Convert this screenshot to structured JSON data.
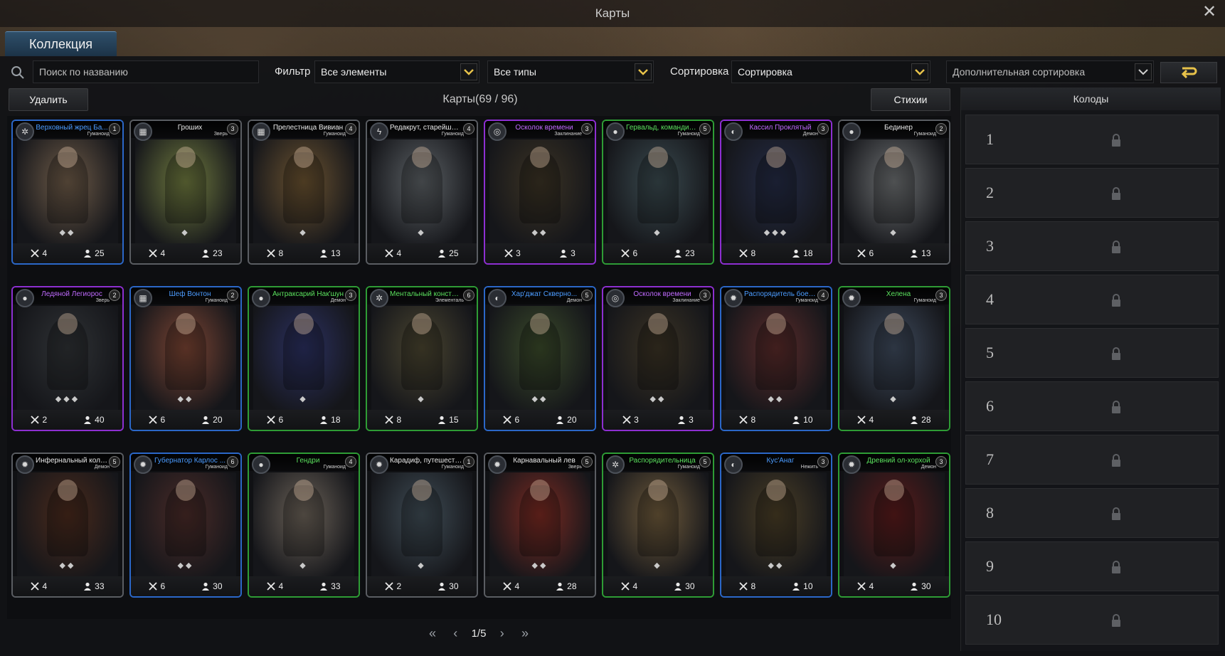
{
  "window": {
    "title": "Карты",
    "close": "✕"
  },
  "tabs": [
    {
      "label": "Коллекция"
    }
  ],
  "toolbar": {
    "search_placeholder": "Поиск по названию",
    "filter_label": "Фильтр",
    "element_filter": "Все элементы",
    "type_filter": "Все типы",
    "sort_label": "Сортировка",
    "sort_value": "Сортировка",
    "extra_sort": "Дополнительная сортировка",
    "apply_icon": "return-arrow-icon"
  },
  "actions": {
    "delete": "Удалить",
    "elements": "Стихии"
  },
  "collection": {
    "count_label": "Карты(69 / 96)"
  },
  "cards": [
    {
      "name": "Верховный жрец Ба...",
      "type": "Гуманоид",
      "cost": "1",
      "attack": "4",
      "health": "25",
      "rarity": "blue",
      "elem": "✲",
      "gems": "◆◆",
      "tint": "#6e5b48"
    },
    {
      "name": "Гроших",
      "type": "Зверь",
      "cost": "3",
      "attack": "4",
      "health": "23",
      "rarity": "grey",
      "elem": "▦",
      "gems": "◆",
      "tint": "#6f7a3f"
    },
    {
      "name": "Прелестница Вивиан",
      "type": "Гуманоид",
      "cost": "4",
      "attack": "8",
      "health": "13",
      "rarity": "grey",
      "elem": "▦",
      "gems": "◆",
      "tint": "#6a5230"
    },
    {
      "name": "Редакрут, старейшин...",
      "type": "Гуманоид",
      "cost": "4",
      "attack": "4",
      "health": "25",
      "rarity": "grey",
      "elem": "ϟ",
      "gems": "◆",
      "tint": "#5b6064"
    },
    {
      "name": "Осколок времени",
      "type": "Заклинание",
      "cost": "3",
      "attack": "3",
      "health": "3",
      "rarity": "purple",
      "elem": "◎",
      "gems": "◆◆",
      "tint": "#3b3324"
    },
    {
      "name": "Гервальд, командир ...",
      "type": "Гуманоид",
      "cost": "5",
      "attack": "6",
      "health": "23",
      "rarity": "green",
      "elem": "●",
      "gems": "◆",
      "tint": "#3a4a4f"
    },
    {
      "name": "Кассил Проклятый",
      "type": "Демон",
      "cost": "3",
      "attack": "8",
      "health": "18",
      "rarity": "purple",
      "elem": "◐",
      "gems": "◆◆◆",
      "tint": "#242b45"
    },
    {
      "name": "Бединер",
      "type": "Гуманоид",
      "cost": "2",
      "attack": "6",
      "health": "13",
      "rarity": "grey",
      "elem": "●",
      "gems": "◆",
      "tint": "#6d7072"
    },
    {
      "name": "Ледяной Легиорос",
      "type": "Зверь",
      "cost": "2",
      "attack": "2",
      "health": "40",
      "rarity": "purple",
      "elem": "●",
      "gems": "◆◆◆",
      "tint": "#2f3235"
    },
    {
      "name": "Шеф Вонтон",
      "type": "Гуманоид",
      "cost": "2",
      "attack": "6",
      "health": "20",
      "rarity": "blue",
      "elem": "▦",
      "gems": "◆◆",
      "tint": "#7a4433"
    },
    {
      "name": "Антраксарий Нак'шун",
      "type": "Демон",
      "cost": "3",
      "attack": "6",
      "health": "18",
      "rarity": "green",
      "elem": "●",
      "gems": "◆",
      "tint": "#2b3060"
    },
    {
      "name": "Ментальный констру...",
      "type": "Элементаль",
      "cost": "6",
      "attack": "8",
      "health": "15",
      "rarity": "green",
      "elem": "✲",
      "gems": "◆",
      "tint": "#4a4530"
    },
    {
      "name": "Хар'джат Скверно...",
      "type": "Демон",
      "cost": "5",
      "attack": "6",
      "health": "20",
      "rarity": "blue",
      "elem": "◐",
      "gems": "◆◆",
      "tint": "#3a4a2a"
    },
    {
      "name": "Осколок времени",
      "type": "Заклинание",
      "cost": "3",
      "attack": "3",
      "health": "3",
      "rarity": "purple",
      "elem": "◎",
      "gems": "◆◆",
      "tint": "#3b3324"
    },
    {
      "name": "Распорядитель боев...",
      "type": "Гуманоид",
      "cost": "4",
      "attack": "8",
      "health": "10",
      "rarity": "blue",
      "elem": "✹",
      "gems": "◆◆",
      "tint": "#5a2b2a"
    },
    {
      "name": "Хелена",
      "type": "Гуманоид",
      "cost": "3",
      "attack": "4",
      "health": "28",
      "rarity": "green",
      "elem": "✹",
      "gems": "◆",
      "tint": "#3e4a5c"
    },
    {
      "name": "Инфернальный коло...",
      "type": "Демон",
      "cost": "5",
      "attack": "4",
      "health": "33",
      "rarity": "grey",
      "elem": "✹",
      "gems": "◆◆",
      "tint": "#4a2a1c"
    },
    {
      "name": "Губернатор Карлос ...",
      "type": "Гуманоид",
      "cost": "6",
      "attack": "6",
      "health": "30",
      "rarity": "blue",
      "elem": "✹",
      "gems": "◆◆",
      "tint": "#4a2b28"
    },
    {
      "name": "Гендри",
      "type": "Гуманоид",
      "cost": "4",
      "attack": "4",
      "health": "33",
      "rarity": "green",
      "elem": "●",
      "gems": "◆",
      "tint": "#6b6258"
    },
    {
      "name": "Карадиф, путешествен...",
      "type": "Гуманоид",
      "cost": "1",
      "attack": "2",
      "health": "30",
      "rarity": "grey",
      "elem": "✹",
      "gems": "◆",
      "tint": "#3f4c55"
    },
    {
      "name": "Карнавальный лев",
      "type": "Зверь",
      "cost": "5",
      "attack": "4",
      "health": "28",
      "rarity": "grey",
      "elem": "✹",
      "gems": "◆◆",
      "tint": "#7a2a22"
    },
    {
      "name": "Распорядительница",
      "type": "Гуманоид",
      "cost": "5",
      "attack": "4",
      "health": "30",
      "rarity": "green",
      "elem": "✲",
      "gems": "◆",
      "tint": "#6e5a3b"
    },
    {
      "name": "Кус'Анаг",
      "type": "Нежить",
      "cost": "3",
      "attack": "8",
      "health": "10",
      "rarity": "blue",
      "elem": "◐",
      "gems": "◆◆",
      "tint": "#4a3e26"
    },
    {
      "name": "Древний ол-хорхой",
      "type": "Демон",
      "cost": "3",
      "attack": "4",
      "health": "30",
      "rarity": "green",
      "elem": "✹",
      "gems": "◆",
      "tint": "#5a1b1b"
    }
  ],
  "pagination": {
    "first": "«",
    "prev": "‹",
    "page": "1/5",
    "next": "›",
    "last": "»"
  },
  "decks": {
    "title": "Колоды",
    "items": [
      "1",
      "2",
      "3",
      "4",
      "5",
      "6",
      "7",
      "8",
      "9",
      "10"
    ]
  }
}
